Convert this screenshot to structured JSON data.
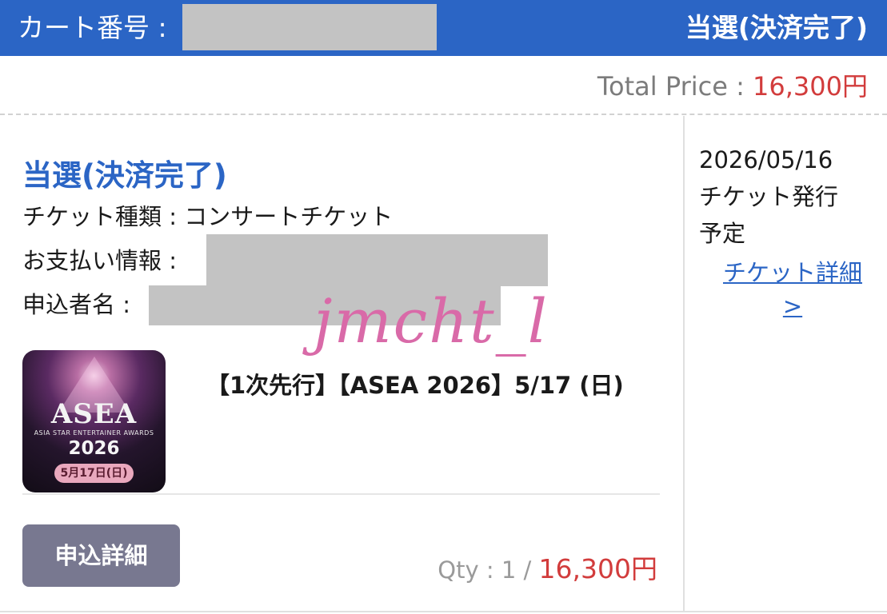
{
  "header": {
    "cart_label": "カート番号 :",
    "status": "当選(決済完了)"
  },
  "total": {
    "label": "Total Price : ",
    "price": "16,300円"
  },
  "item": {
    "status_title": "当選(決済完了)",
    "ticket_type": "チケット種類 : コンサートチケット",
    "payment_label": "お支払い情報 :",
    "applicant_label": "申込者名 :",
    "event_title": "【1次先行】【ASEA 2026】5/17 (日)",
    "detail_button": "申込詳細",
    "qty_label": "Qty : 1 / ",
    "qty_price": "16,300円"
  },
  "thumbnail": {
    "logo": "ASEA",
    "subtitle": "ASIA STAR ENTERTAINER AWARDS",
    "year": "2026",
    "date": "5月17日(日)"
  },
  "side": {
    "issue_date": "2026/05/16",
    "issue_line2": "チケット発行",
    "issue_line3": "予定",
    "link_label": "チケット詳細",
    "link_arrow": ">"
  },
  "watermark": "jmcht_l",
  "colors": {
    "header_blue": "#2b65c5",
    "price_red": "#d23c3c",
    "button_gray": "#787890"
  }
}
